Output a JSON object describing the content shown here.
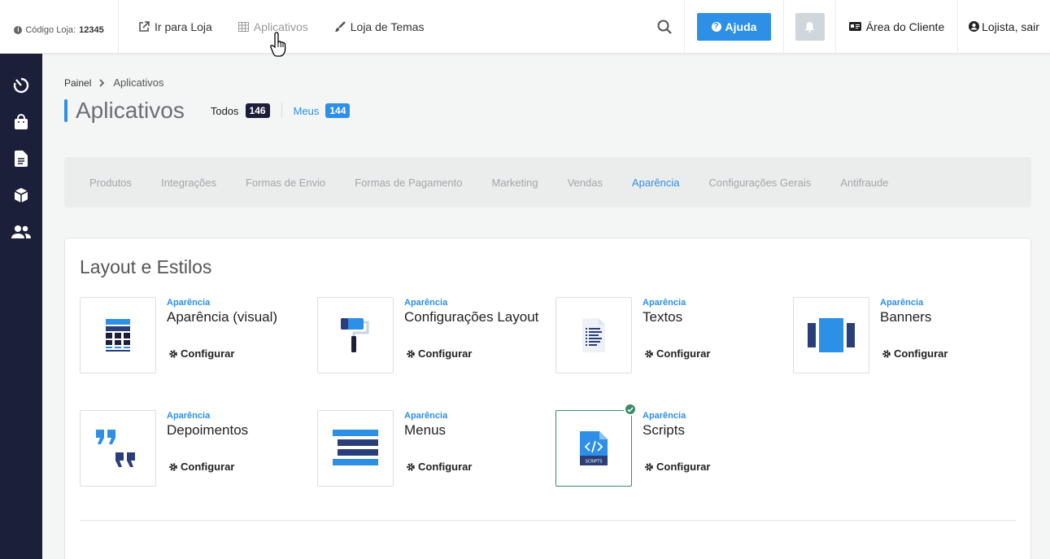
{
  "topbar": {
    "store_code_label": "Código Loja:",
    "store_code": "12345",
    "links": [
      {
        "label": "Ir para Loja",
        "icon": "external-link-icon"
      },
      {
        "label": "Aplicativos",
        "icon": "grid-icon"
      },
      {
        "label": "Loja de Temas",
        "icon": "brush-icon"
      }
    ],
    "help_label": "Ajuda",
    "client_area_label": "Área do Cliente",
    "user_label": "Lojista, sair"
  },
  "sidebar": {
    "items": [
      "dashboard-icon",
      "shopping-bag-icon",
      "document-icon",
      "box-icon",
      "users-icon"
    ]
  },
  "breadcrumb": {
    "root": "Painel",
    "current": "Aplicativos"
  },
  "page": {
    "title": "Aplicativos",
    "filters": [
      {
        "label": "Todos",
        "count": "146"
      },
      {
        "label": "Meus",
        "count": "144"
      }
    ]
  },
  "tabs": [
    "Produtos",
    "Integrações",
    "Formas de Envio",
    "Formas de Pagamento",
    "Marketing",
    "Vendas",
    "Aparência",
    "Configurações Gerais",
    "Antifraude"
  ],
  "active_tab": "Aparência",
  "section": {
    "title": "Layout e Estilos",
    "configure_label": "Configurar",
    "apps": [
      {
        "category": "Aparência",
        "name": "Aparência (visual)",
        "icon": "layout-icon",
        "installed": false
      },
      {
        "category": "Aparência",
        "name": "Configurações Layout",
        "icon": "paint-roller-icon",
        "installed": false
      },
      {
        "category": "Aparência",
        "name": "Textos",
        "icon": "text-file-icon",
        "installed": false
      },
      {
        "category": "Aparência",
        "name": "Banners",
        "icon": "banners-icon",
        "installed": false
      },
      {
        "category": "Aparência",
        "name": "Depoimentos",
        "icon": "quotes-icon",
        "installed": false
      },
      {
        "category": "Aparência",
        "name": "Menus",
        "icon": "menu-icon",
        "installed": false
      },
      {
        "category": "Aparência",
        "name": "Scripts",
        "icon": "scripts-icon",
        "installed": true
      }
    ]
  },
  "colors": {
    "accent": "#2d8fe6",
    "sidebar": "#1c1f3a",
    "installed": "#3a8a6b"
  }
}
